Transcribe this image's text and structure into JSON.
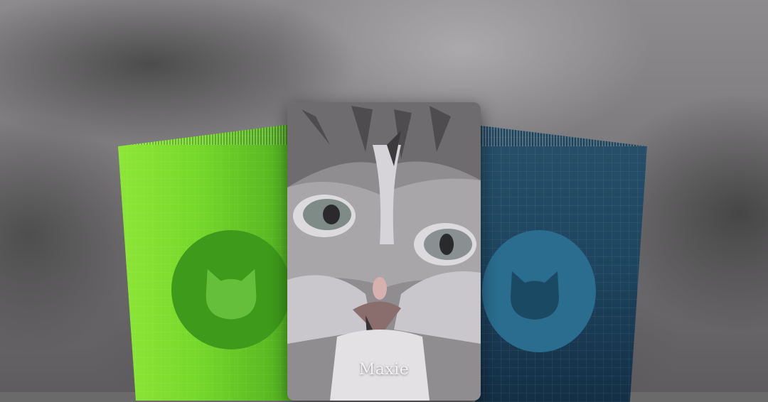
{
  "background": {
    "description_color": "#6b6a6b"
  },
  "packs": [
    {
      "id": "left",
      "color": "#76d82a",
      "badge_color": "#3e9a1a",
      "icon": "cat-head-icon"
    },
    {
      "id": "right",
      "color": "#1e4560",
      "badge_color": "#2a6d8e",
      "icon": "cat-head-icon"
    }
  ],
  "center_card": {
    "name": "Maxie",
    "image": "cat-portrait"
  }
}
